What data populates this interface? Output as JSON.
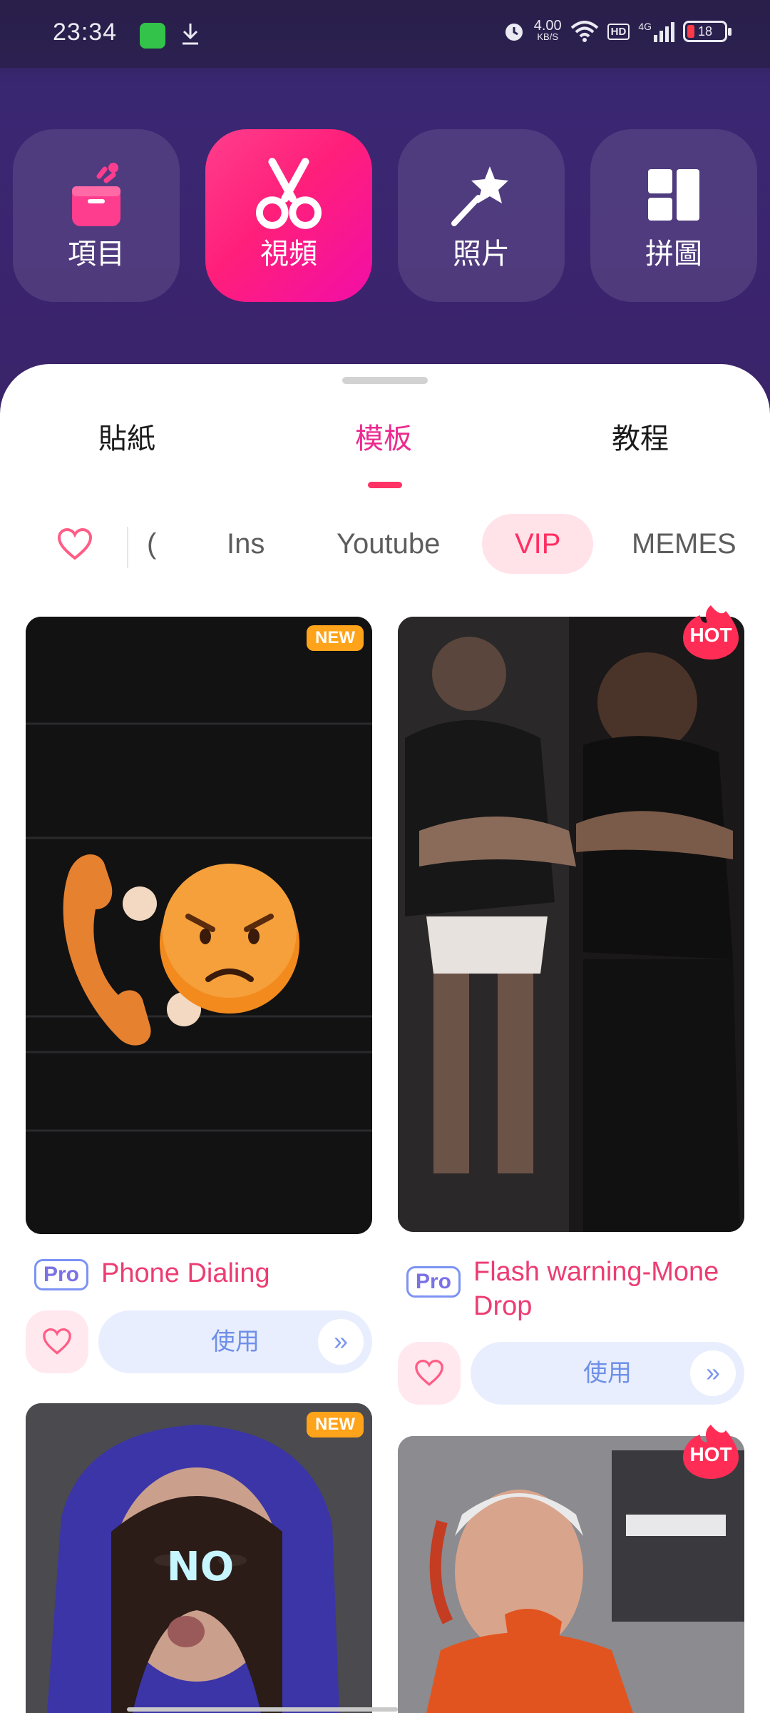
{
  "status_bar": {
    "time": "23:34",
    "net_speed_value": "4.00",
    "net_speed_unit": "KB/S",
    "hd_label": "HD",
    "signal_label": "4G",
    "battery": "18",
    "icons": [
      "messages-app-icon",
      "download-icon",
      "alarm-icon",
      "wifi-icon",
      "hd-icon",
      "signal-icon",
      "battery-icon"
    ]
  },
  "nav_tiles": [
    {
      "label": "項目",
      "icon": "project-icon",
      "active": false
    },
    {
      "label": "視頻",
      "icon": "scissors-icon",
      "active": true
    },
    {
      "label": "照片",
      "icon": "magic-wand-icon",
      "active": false
    },
    {
      "label": "拼圖",
      "icon": "collage-icon",
      "active": false
    }
  ],
  "tabs": [
    {
      "label": "貼紙",
      "active": false
    },
    {
      "label": "模板",
      "active": true
    },
    {
      "label": "教程",
      "active": false
    }
  ],
  "categories": {
    "partial": "(",
    "items": [
      {
        "label": "Ins",
        "active": false
      },
      {
        "label": "Youtube",
        "active": false
      },
      {
        "label": "VIP",
        "active": true
      },
      {
        "label": "MEMES",
        "active": false
      }
    ]
  },
  "cards": [
    {
      "badge": "NEW",
      "pro": "Pro",
      "title": "Phone Dialing",
      "use_label": "使用",
      "arrow": "»"
    },
    {
      "badge": "HOT",
      "pro": "Pro",
      "title": "Flash warning-Mone\nDrop",
      "use_label": "使用",
      "arrow": "»"
    },
    {
      "badge": "NEW",
      "overlay_text": "NO"
    },
    {
      "badge": "HOT"
    }
  ],
  "colors": {
    "accent_pink": "#ec2a8f",
    "active_tile": "#ff1f7a",
    "title_pink": "#ec3d72",
    "use_button_bg": "#e8eefd",
    "new_badge": "#ffa31a",
    "hot_badge": "#ff2d55"
  }
}
